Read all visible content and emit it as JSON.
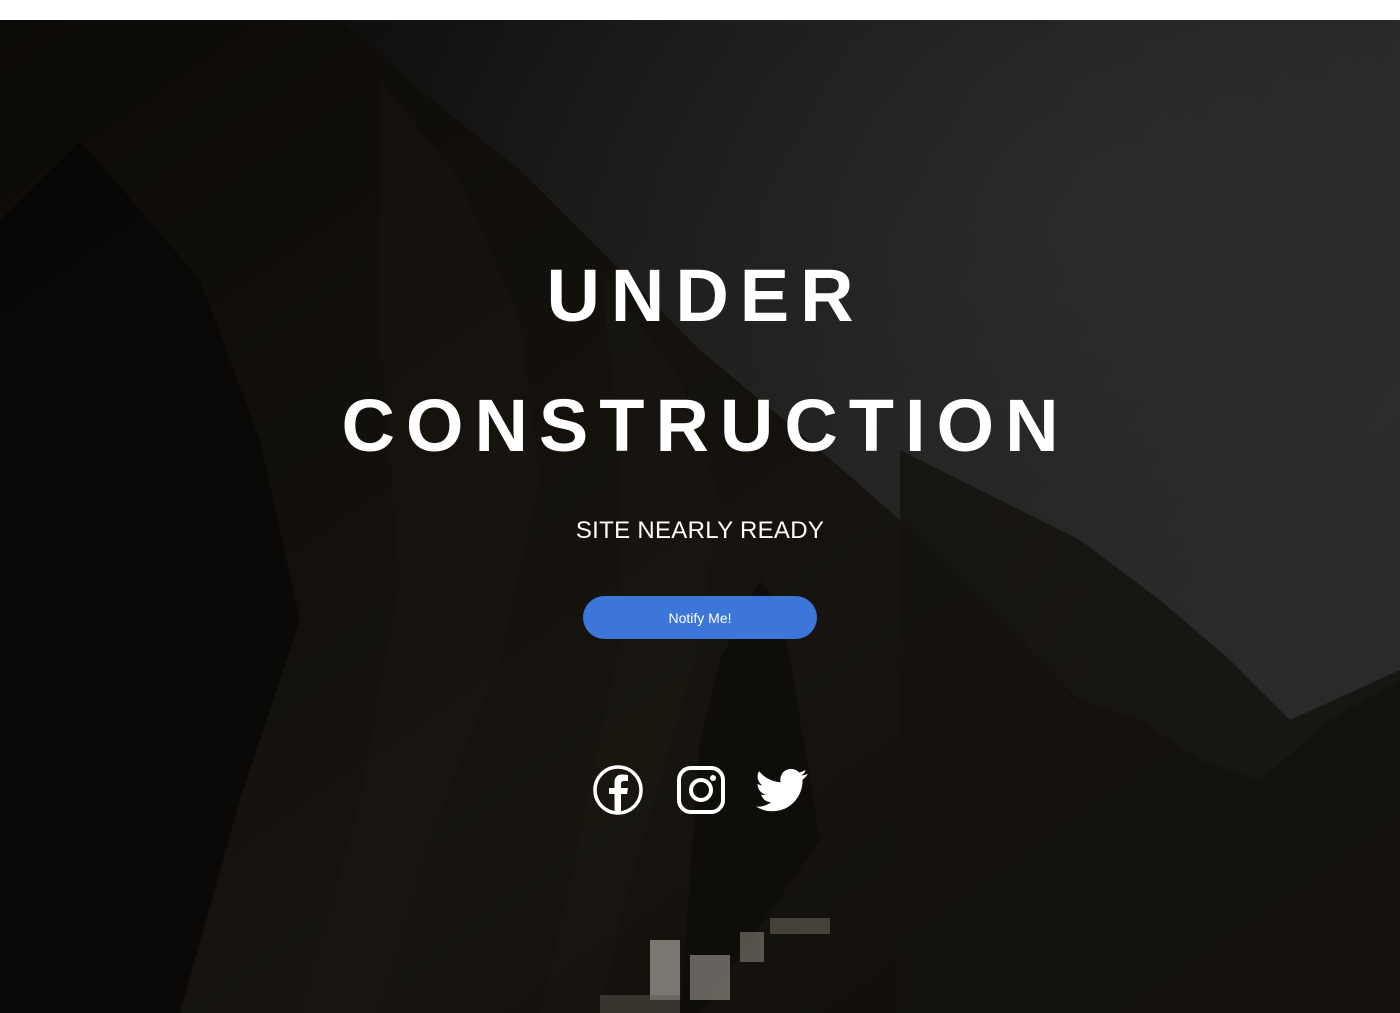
{
  "hero": {
    "title_line1": "UNDER",
    "title_line2": "CONSTRUCTION",
    "subtitle": "SITE NEARLY READY",
    "notify_label": "Notify Me!"
  },
  "social": {
    "icons": [
      "facebook-icon",
      "instagram-icon",
      "twitter-icon"
    ]
  },
  "colors": {
    "button": "#3b76d8",
    "text": "#ffffff",
    "background": "#0b0a09"
  }
}
